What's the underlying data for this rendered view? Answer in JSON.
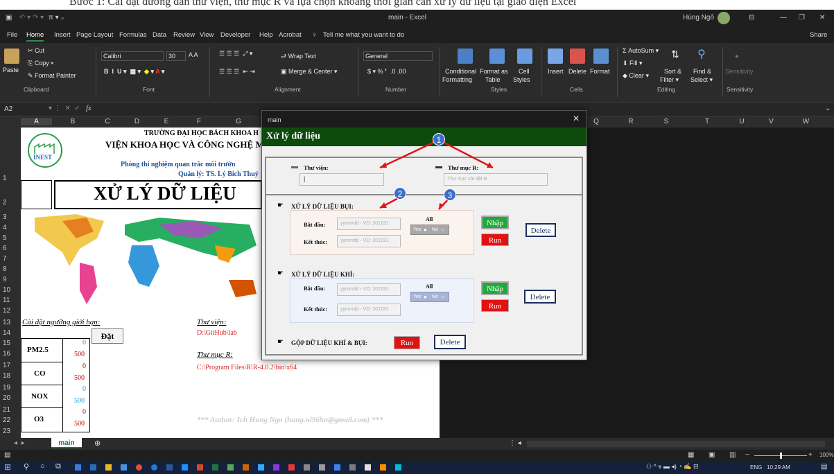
{
  "caption": "Bước 1: Cài đặt đường dẫn thư viện, thư mục R và lựa chọn khoảng thời gian cần xử lý dữ liệu tại giao diện Excel",
  "titlebar": {
    "title": "main  -  Excel",
    "user": "Hùng Ngô"
  },
  "tabs": [
    "File",
    "Home",
    "Insert",
    "Page Layout",
    "Formulas",
    "Data",
    "Review",
    "View",
    "Developer",
    "Help",
    "Acrobat"
  ],
  "tell_me": "Tell me what you want to do",
  "share": "Share",
  "ribbon": {
    "paste": "Paste",
    "cut": "Cut",
    "copy": "Copy",
    "format_painter": "Format Painter",
    "clipboard": "Clipboard",
    "font_name": "Calibri",
    "font_size": "30",
    "font": "Font",
    "wrap_text": "Wrap Text",
    "merge_center": "Merge & Center",
    "alignment": "Alignment",
    "number_format": "General",
    "number": "Number",
    "conditional": "Conditional",
    "formatting": "Formatting",
    "format_as": "Format as",
    "table": "Table",
    "cell": "Cell",
    "styles_btn": "Styles",
    "styles": "Styles",
    "insert": "Insert",
    "delete": "Delete",
    "format": "Format",
    "cells": "Cells",
    "autosum": "AutoSum",
    "fill": "Fill",
    "clear": "Clear",
    "sort": "Sort &",
    "filter": "Filter",
    "find": "Find &",
    "select": "Select",
    "editing": "Editing",
    "sensitivity": "Sensitivity"
  },
  "formula_bar": {
    "name_box": "A2",
    "fx": "fx"
  },
  "columns": [
    "A",
    "B",
    "C",
    "D",
    "E",
    "F",
    "G",
    "Q",
    "R",
    "S",
    "T",
    "U",
    "V",
    "W"
  ],
  "rows": [
    "1",
    "2",
    "3",
    "4",
    "5",
    "6",
    "7",
    "8",
    "9",
    "10",
    "11",
    "12",
    "13",
    "14",
    "15",
    "16",
    "17",
    "18",
    "19",
    "20",
    "21",
    "22",
    "23"
  ],
  "sheet": {
    "uni": "TRƯỜNG ĐẠI HỌC BÁCH KHOA H",
    "inst": "VIỆN KHOA HỌC VÀ CÔNG NGHỆ M",
    "lab": "Phòng thí nghiệm quan trắc môi trườn",
    "manager": "Quản lý: TS. Lý Bích Thuỷ",
    "logo": "INEST",
    "title": "XỬ LÝ DỮ LIỆU",
    "threshold_label": "Cài đặt ngưỡng giới hạn:",
    "set_btn": "Đặt",
    "lib_label": "Thư viện:",
    "lib_path": "D:\\GitHub\\lab",
    "r_label": "Thư mục R:",
    "r_path": "C:\\Program Files\\R\\R-4.0.2\\bin\\x64",
    "author": "*** Author: Ich Hung Ngo (hung.ni96hn@gmail.com) ***",
    "pollutants": [
      {
        "name": "PM2.5",
        "min": "0",
        "max": "500",
        "color": "#2aa12a"
      },
      {
        "name": "CO",
        "min": "0",
        "max": "500",
        "color": "#7a1f1f"
      },
      {
        "name": "NOX",
        "min": "0",
        "max": "500",
        "color": "#1ea0d8"
      },
      {
        "name": "O3",
        "min": "0",
        "max": "500",
        "color": "#c00000"
      }
    ]
  },
  "sheet_tab": "main",
  "dialog": {
    "window_title": "main",
    "header": "Xử lý dữ liệu",
    "lib_label": "Thư viện:",
    "lib_value": "|",
    "rdir_label": "Thư mục R:",
    "rdir_placeholder": "Thư mục cài đặt R",
    "dust_title": "XỬ LÝ DỮ LIỆU BỤI:",
    "gas_title": "XỬ LÝ DỮ LIỆU KHÍ:",
    "merge_title": "GỘP DỮ LIỆU KHÍ & BỤI:",
    "start": "Bắt đầu:",
    "end": "Kết thúc:",
    "date_placeholder": "yymmdd - VD: 201231",
    "all": "All",
    "yes": "Yes",
    "no": "No",
    "import": "Nhập",
    "run": "Run",
    "delete": "Delete",
    "badges": [
      "1",
      "2",
      "3"
    ]
  },
  "status": {
    "zoom": "100%",
    "lang": "ENG",
    "time": "10:29 AM"
  }
}
